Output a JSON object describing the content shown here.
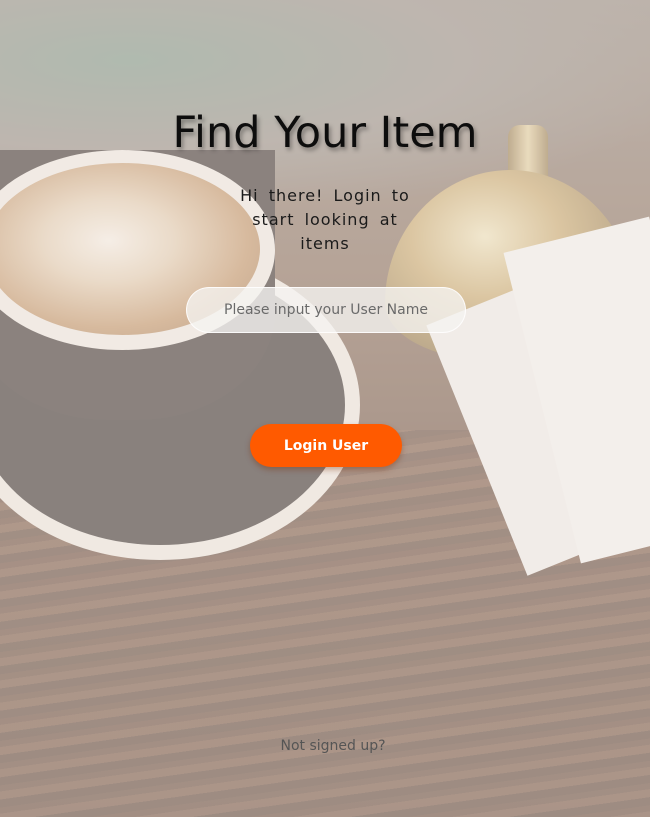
{
  "page": {
    "title": "Find Your Item",
    "subtitle": "Hi there! Login to start looking at items"
  },
  "login_form": {
    "username_placeholder": "Please input your User Name",
    "username_value": "",
    "submit_label": "Login User"
  },
  "footer": {
    "signup_link": "Not signed up?"
  },
  "colors": {
    "accent": "#ff5a00",
    "title_text": "#0d0d0d",
    "link_text": "#555555"
  }
}
